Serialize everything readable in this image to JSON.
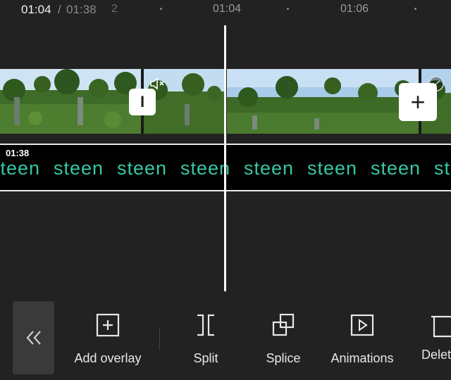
{
  "timeline": {
    "current_time": "01:04",
    "separator": "/",
    "total_time": "01:38",
    "fraction_hint": "2",
    "ruler_labels": [
      "01:04",
      "01:06"
    ]
  },
  "video_track": {
    "mute_icon": "speaker-mute-icon",
    "transition_icon": "transition-icon",
    "split_marker_label": "I",
    "add_clip_label": "+"
  },
  "text_track": {
    "duration": "01:38",
    "repeated_text": "steen",
    "text_color": "#36c7a4"
  },
  "toolbar": {
    "back_icon": "double-chevron-left-icon",
    "items": [
      {
        "label": "Add overlay",
        "icon": "add-overlay-icon"
      },
      {
        "label": "Split",
        "icon": "split-icon"
      },
      {
        "label": "Splice",
        "icon": "splice-icon"
      },
      {
        "label": "Animations",
        "icon": "animations-icon"
      },
      {
        "label": "Delet",
        "icon": "delete-icon"
      }
    ]
  },
  "colors": {
    "background": "#222222",
    "accent_text": "#36c7a4",
    "playhead": "#ffffff"
  }
}
